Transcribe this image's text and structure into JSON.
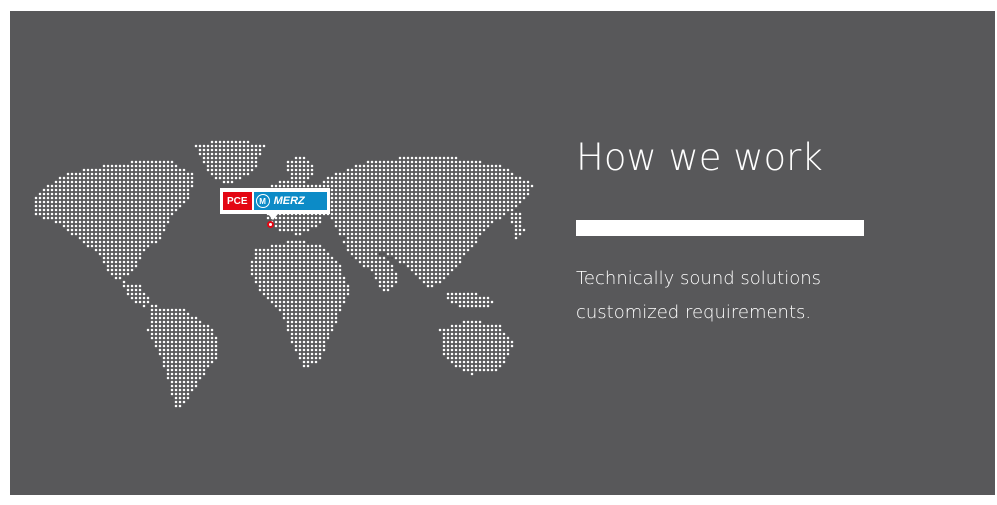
{
  "section": {
    "headline": "How we work",
    "description_lines": [
      "Technically sound solutions",
      "customized requirements."
    ]
  },
  "logo": {
    "left_text": "PCE",
    "badge_letter": "M",
    "right_text": "MERZ",
    "colors": {
      "left": "#e30613",
      "right": "#0c8bc7"
    }
  },
  "colors": {
    "panel_background": "#58585a",
    "page_background": "#ffffff",
    "foreground": "#ffffff"
  },
  "map": {
    "icon": "dotted-world-map-icon"
  }
}
